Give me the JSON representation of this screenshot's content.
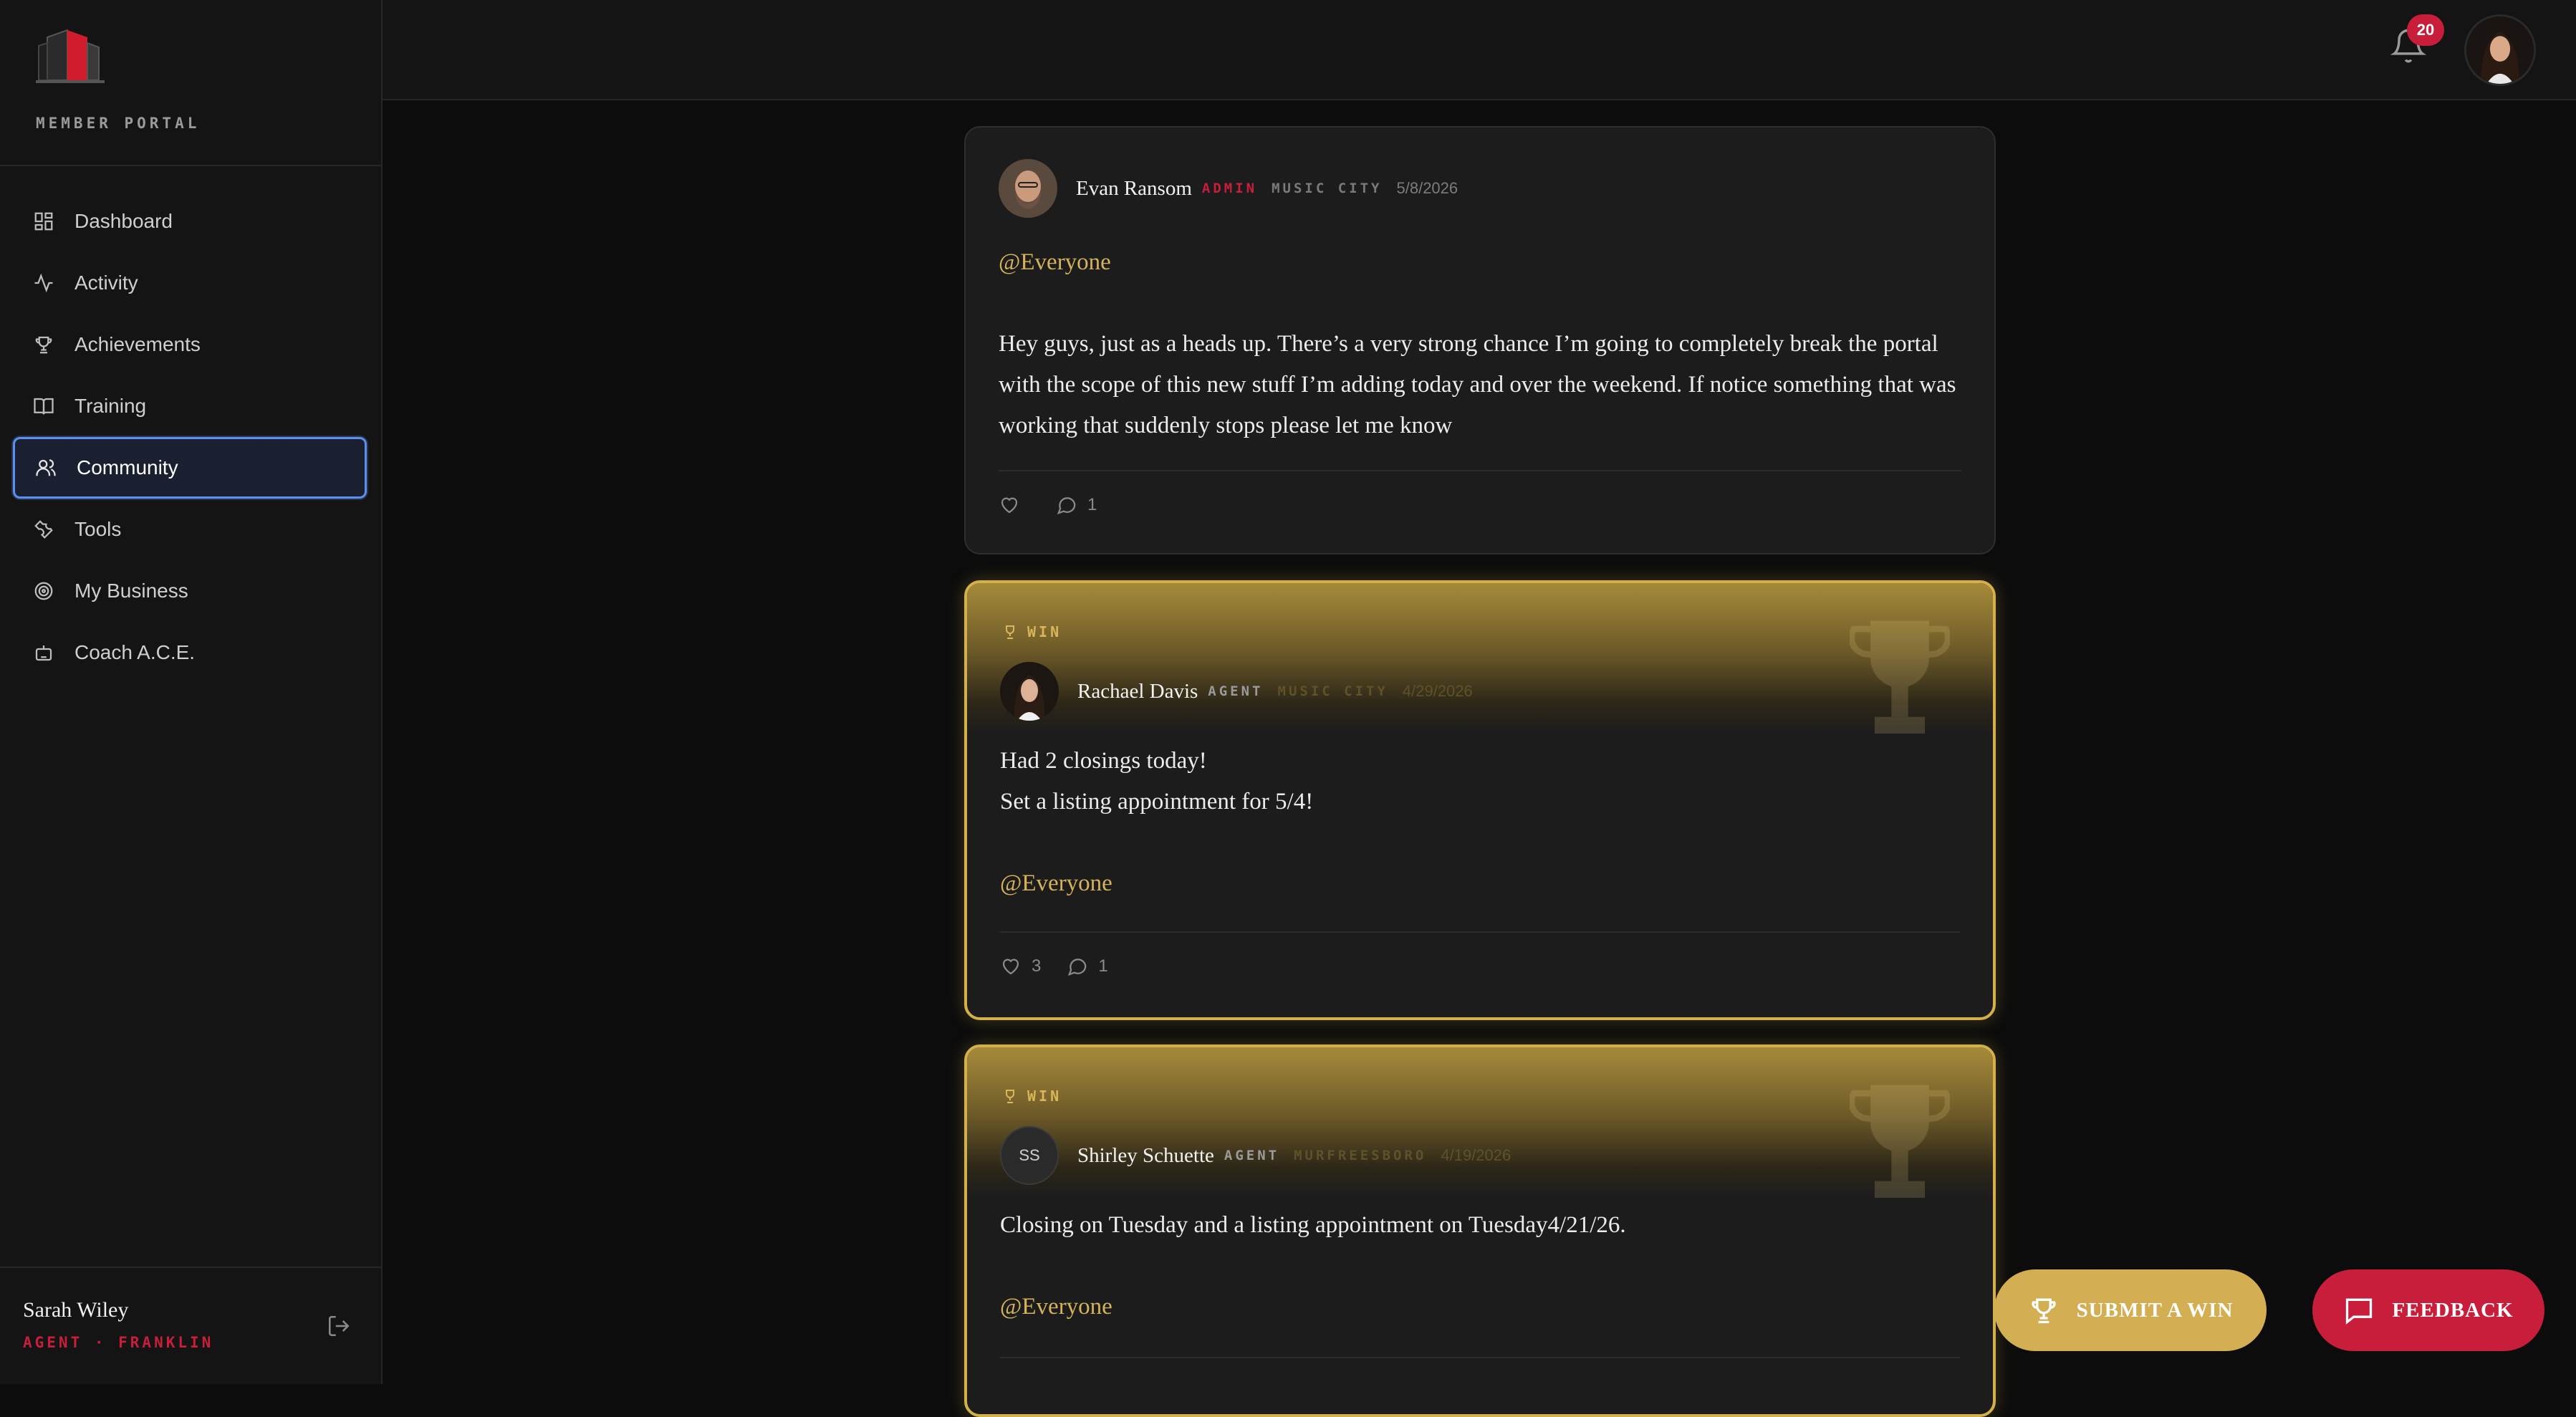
{
  "sidebar": {
    "portal_label": "MEMBER PORTAL",
    "nav": [
      {
        "label": "Dashboard",
        "icon": "dashboard-icon"
      },
      {
        "label": "Activity",
        "icon": "activity-icon"
      },
      {
        "label": "Achievements",
        "icon": "trophy-icon"
      },
      {
        "label": "Training",
        "icon": "book-icon"
      },
      {
        "label": "Community",
        "icon": "users-icon",
        "active": true
      },
      {
        "label": "Tools",
        "icon": "wrench-icon"
      },
      {
        "label": "My Business",
        "icon": "target-icon"
      },
      {
        "label": "Coach A.C.E.",
        "icon": "bot-icon"
      }
    ],
    "user": {
      "name": "Sarah Wiley",
      "role": "AGENT · FRANKLIN"
    }
  },
  "topbar": {
    "notification_count": "20"
  },
  "posts": [
    {
      "author": "Evan Ransom",
      "role": "ADMIN",
      "office": "MUSIC CITY",
      "date": "5/8/2026",
      "mention": "@Everyone",
      "body": "Hey guys,  just as a heads up.  There’s a very strong chance I’m going to completely break the portal with the scope of this new stuff I’m adding today and over the weekend.  If notice something that was working that suddenly stops please let me know",
      "likes": "",
      "comments": "1"
    },
    {
      "tag": "WIN",
      "author": "Rachael Davis",
      "role": "AGENT",
      "office": "MUSIC CITY",
      "date": "4/29/2026",
      "body_line1": "Had 2 closings today!",
      "body_line2": "Set a listing appointment for 5/4!",
      "mention": "@Everyone",
      "likes": "3",
      "comments": "1"
    },
    {
      "tag": "WIN",
      "author": "Shirley Schuette",
      "initials": "SS",
      "role": "AGENT",
      "office": "MURFREESBORO",
      "date": "4/19/2026",
      "body": "Closing on Tuesday and a listing appointment on Tuesday4/21/26.",
      "mention": "@Everyone"
    }
  ],
  "buttons": {
    "submit_win": "SUBMIT A WIN",
    "feedback": "FEEDBACK"
  },
  "colors": {
    "accent_red": "#c81e3c",
    "win_gold": "#d4b04c",
    "active_blue": "#5b8ff0"
  }
}
